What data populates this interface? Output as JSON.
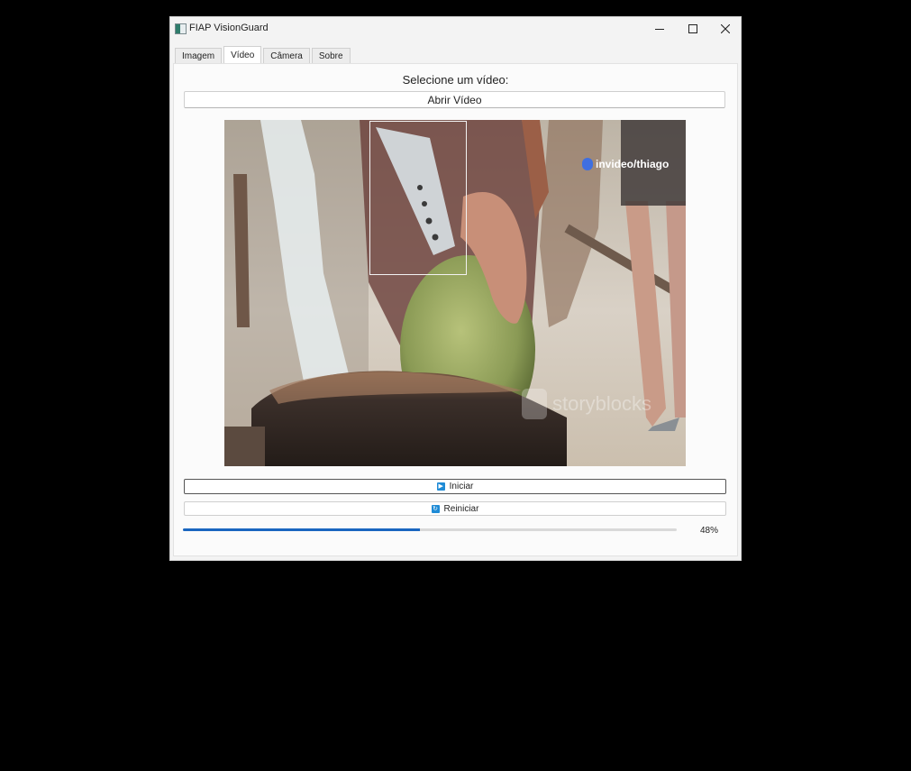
{
  "window": {
    "title": "FIAP VisionGuard",
    "controls": {
      "minimize": "minimize",
      "maximize": "maximize",
      "close": "close"
    }
  },
  "tabs": [
    {
      "label": "Imagem",
      "active": false
    },
    {
      "label": "Vídeo",
      "active": true
    },
    {
      "label": "Câmera",
      "active": false
    },
    {
      "label": "Sobre",
      "active": false
    }
  ],
  "video_tab": {
    "prompt": "Selecione um vídeo:",
    "open_button": "Abrir Vídeo",
    "watermark_top": "invideo/thiago",
    "watermark_bottom": "storyblocks",
    "start_button": "Iniciar",
    "restart_button": "Reiniciar",
    "progress": {
      "value": 0.48,
      "label": "48%"
    }
  },
  "icons": {
    "play": "play-icon",
    "restart": "restart-icon",
    "app": "app-icon"
  },
  "colors": {
    "accent": "#1a66c0",
    "window_bg": "#f3f3f3",
    "panel_bg": "#fbfbfb"
  }
}
